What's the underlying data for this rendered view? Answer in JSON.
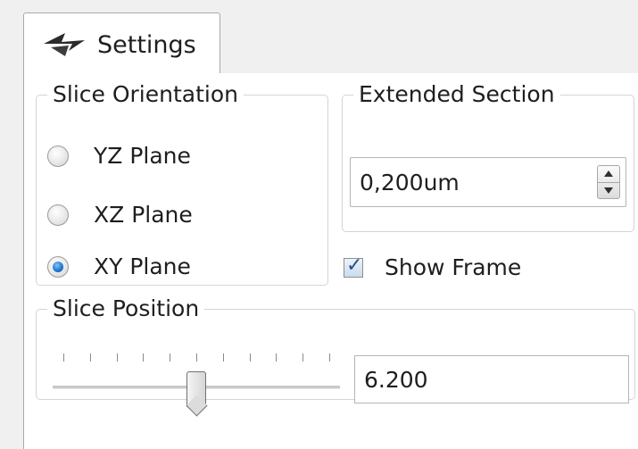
{
  "tabs": [
    {
      "label": "Settings",
      "icon": "settings-arrows-icon",
      "active": true
    }
  ],
  "slice_orientation": {
    "title": "Slice Orientation",
    "options": [
      {
        "label": "YZ Plane",
        "checked": false
      },
      {
        "label": "XZ Plane",
        "checked": false
      },
      {
        "label": "XY Plane",
        "checked": true
      }
    ]
  },
  "extended_section": {
    "title": "Extended Section",
    "value": "0,200um"
  },
  "show_frame": {
    "label": "Show Frame",
    "checked": true
  },
  "slice_position": {
    "title": "Slice Position",
    "slider_fraction": 0.5,
    "tick_count": 11,
    "value": "6.200"
  },
  "colors": {
    "accent_radio": "#1c73c8",
    "pane_background": "#ffffff",
    "window_background": "#f0f0f0"
  }
}
